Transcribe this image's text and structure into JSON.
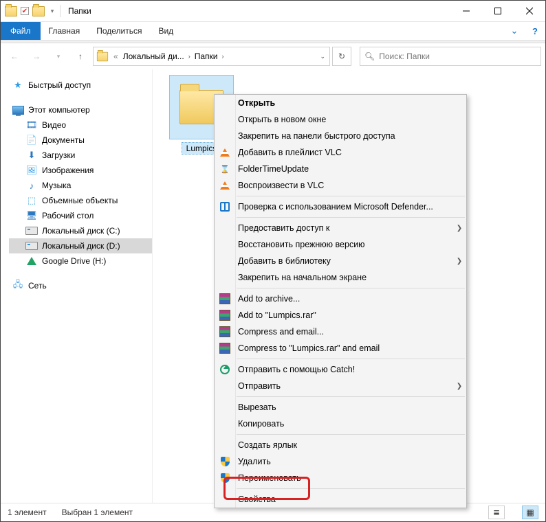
{
  "title": "Папки",
  "ribbon": {
    "file": "Файл",
    "home": "Главная",
    "share": "Поделиться",
    "view": "Вид"
  },
  "breadcrumbs": {
    "overflow": "«",
    "d1": "Локальный ди...",
    "d2": "Папки"
  },
  "search_placeholder": "Поиск: Папки",
  "tree": {
    "quick": "Быстрый доступ",
    "pc": "Этот компьютер",
    "video": "Видео",
    "docs": "Документы",
    "down": "Загрузки",
    "img": "Изображения",
    "music": "Музыка",
    "obj": "Объемные объекты",
    "desk": "Рабочий стол",
    "c": "Локальный диск (C:)",
    "d": "Локальный диск (D:)",
    "g": "Google Drive (H:)",
    "net": "Сеть"
  },
  "item_name": "Lumpics",
  "ctx": {
    "open": "Открыть",
    "open_new": "Открыть в новом окне",
    "pin_quick": "Закрепить на панели быстрого доступа",
    "vlc_add": "Добавить в плейлист VLC",
    "ftu": "FolderTimeUpdate",
    "vlc_play": "Воспроизвести в VLC",
    "defender": "Проверка с использованием Microsoft Defender...",
    "access": "Предоставить доступ к",
    "restore": "Восстановить прежнюю версию",
    "lib": "Добавить в библиотеку",
    "pin_start": "Закрепить на начальном экране",
    "rar1": "Add to archive...",
    "rar2": "Add to \"Lumpics.rar\"",
    "rar3": "Compress and email...",
    "rar4": "Compress to \"Lumpics.rar\" and email",
    "catch": "Отправить с помощью Catch!",
    "send": "Отправить",
    "cut": "Вырезать",
    "copy": "Копировать",
    "shortcut": "Создать ярлык",
    "delete": "Удалить",
    "rename": "Переименовать",
    "props": "Свойства"
  },
  "status": {
    "count": "1 элемент",
    "sel": "Выбран 1 элемент"
  }
}
